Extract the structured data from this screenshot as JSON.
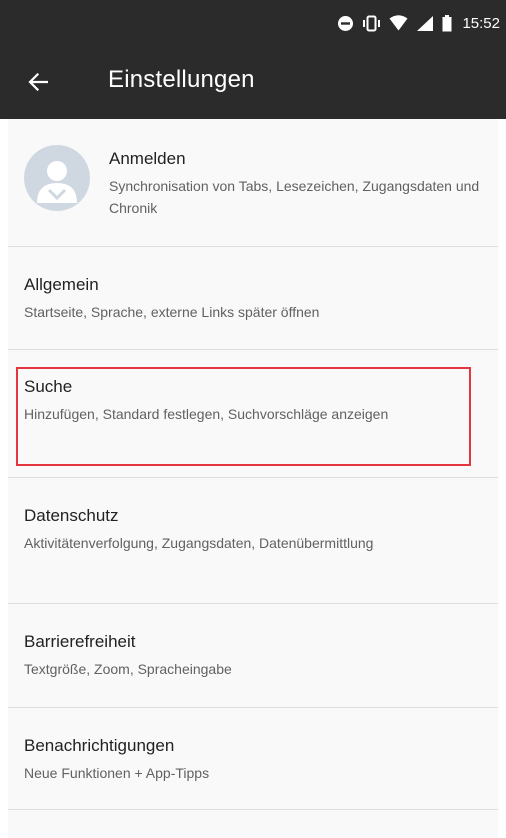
{
  "status_bar": {
    "time": "15:52",
    "icons": [
      "do-not-disturb-icon",
      "vibrate-icon",
      "wifi-icon",
      "signal-icon",
      "battery-icon"
    ]
  },
  "toolbar": {
    "back_icon": "arrow-left-icon",
    "title": "Einstellungen"
  },
  "account": {
    "title": "Anmelden",
    "subtitle": "Synchronisation von Tabs, Lesezeichen, Zugangsdaten und Chronik",
    "avatar_icon": "person-icon"
  },
  "settings": [
    {
      "title": "Allgemein",
      "subtitle": "Startseite, Sprache, externe Links später öffnen"
    },
    {
      "title": "Suche",
      "subtitle": "Hinzufügen, Standard festlegen, Suchvorschläge anzeigen"
    },
    {
      "title": "Datenschutz",
      "subtitle": "Aktivitätenverfolgung, Zugangsdaten, Datenübermittlung"
    },
    {
      "title": "Barrierefreiheit",
      "subtitle": "Textgröße, Zoom, Spracheingabe"
    },
    {
      "title": "Benachrichtigungen",
      "subtitle": "Neue Funktionen + App-Tipps"
    }
  ],
  "colors": {
    "toolbar_bg": "#2b2b2b",
    "content_bg": "#f9f9f9",
    "highlight": "#e4363f",
    "avatar_bg": "#cfd8e1"
  }
}
